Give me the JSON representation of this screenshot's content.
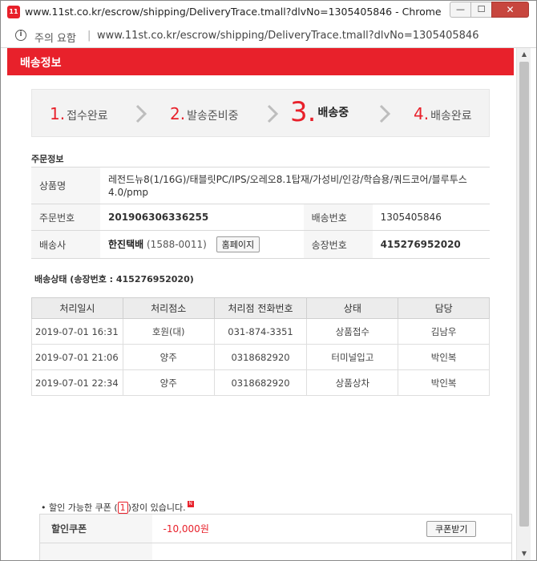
{
  "window": {
    "title": "www.11st.co.kr/escrow/shipping/DeliveryTrace.tmall?dlvNo=1305405846 - Chrome",
    "app_icon_text": "11",
    "not_secure": "주의 요함",
    "url": "www.11st.co.kr/escrow/shipping/DeliveryTrace.tmall?dlvNo=1305405846"
  },
  "page": {
    "header_title": "배송정보",
    "steps": [
      {
        "num": "1.",
        "label": "접수완료"
      },
      {
        "num": "2.",
        "label": "발송준비중"
      },
      {
        "num": "3.",
        "label": "배송중"
      },
      {
        "num": "4.",
        "label": "배송완료"
      }
    ],
    "order_section_title": "주문정보",
    "order": {
      "product_label": "상품명",
      "product_value": "레전드뉴8(1/16G)/태블릿PC/IPS/오레오8.1탑재/가성비/인강/학습용/쿼드코어/블루투스4.0/pmp",
      "order_no_label": "주문번호",
      "order_no_value": "201906306336255",
      "delivery_no_label": "배송번호",
      "delivery_no_value": "1305405846",
      "carrier_label": "배송사",
      "carrier_name": "한진택배",
      "carrier_phone": "(1588-0011)",
      "homepage_button": "홈페이지",
      "invoice_label": "송장번호",
      "invoice_value": "415276952020"
    },
    "tracking_section_title": "배송상태 (송장번호 : 415276952020)",
    "tracking": {
      "headers": [
        "처리일시",
        "처리점소",
        "처리점 전화번호",
        "상태",
        "담당"
      ],
      "rows": [
        [
          "2019-07-01 16:31",
          "호원(대)",
          "031-874-3351",
          "상품접수",
          "김남우"
        ],
        [
          "2019-07-01 21:06",
          "양주",
          "0318682920",
          "터미널입고",
          "박인복"
        ],
        [
          "2019-07-01 22:34",
          "양주",
          "0318682920",
          "상품상차",
          "박인복"
        ]
      ]
    },
    "coupon": {
      "note_prefix": "• 할인 가능한 쿠폰 (",
      "note_count": "1",
      "note_suffix": ")장이 있습니다.",
      "new_badge": "N",
      "label": "할인쿠폰",
      "amount": "-10,000원",
      "button": "쿠폰받기"
    }
  },
  "colors": {
    "brand_red": "#e8212b",
    "close_button": "#c7463e"
  }
}
